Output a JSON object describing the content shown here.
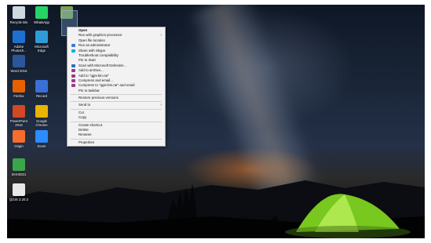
{
  "desktop_icons": [
    {
      "label": "Recycle Bin",
      "icon": "recycle-bin-icon",
      "color": "#cfd8e0"
    },
    {
      "label": "WhatsApp",
      "icon": "whatsapp-icon",
      "color": "#25d366"
    },
    {
      "label": "",
      "icon": "app-icon",
      "color": "#7ea04a"
    },
    {
      "label": "Adobe\nPhotosh...",
      "icon": "photoshop-icon",
      "color": "#1f6fd0"
    },
    {
      "label": "Microsoft\nEdge",
      "icon": "edge-icon",
      "color": "#2f9ad8"
    },
    {
      "label": "Word 2016",
      "icon": "word-icon",
      "color": "#2b579a"
    },
    {
      "label": "Firefox",
      "icon": "firefox-icon",
      "color": "#e66000"
    },
    {
      "label": "Record",
      "icon": "record-icon",
      "color": "#3a6fd8"
    },
    {
      "label": "PowerPoint\n2016",
      "icon": "powerpoint-icon",
      "color": "#d24726"
    },
    {
      "label": "Google\nChrome",
      "icon": "chrome-icon",
      "color": "#e8b400"
    },
    {
      "label": "Origin",
      "icon": "origin-icon",
      "color": "#f56c2d"
    },
    {
      "label": "Zoom",
      "icon": "zoom-icon",
      "color": "#2d8cff"
    },
    {
      "label": "SHH2021",
      "icon": "shh-icon",
      "color": "#3aa54a"
    },
    {
      "label": "QGIS 3.20.3",
      "icon": "qgis-icon",
      "color": "#e8e8e8"
    }
  ],
  "context_menu": [
    {
      "label": "Open",
      "bold": true
    },
    {
      "label": "Run with graphics processor",
      "submenu": true
    },
    {
      "label": "Open file location"
    },
    {
      "label": "Run as administrator",
      "icon": "shield-icon",
      "color": "#3a7bd5"
    },
    {
      "label": "Share with Skype",
      "icon": "skype-icon",
      "color": "#00aff0"
    },
    {
      "label": "Troubleshoot compatibility"
    },
    {
      "label": "Pin to Start"
    },
    {
      "label": "Scan with Microsoft Defender...",
      "icon": "defender-icon",
      "color": "#2f6fbf"
    },
    {
      "label": "Add to archive...",
      "icon": "archive-icon",
      "color": "#9b3a8c"
    },
    {
      "label": "Add to \"qgis-bin.rar\"",
      "icon": "archive-icon",
      "color": "#9b3a8c"
    },
    {
      "label": "Compress and email...",
      "icon": "archive-icon",
      "color": "#9b3a8c"
    },
    {
      "label": "Compress to \"qgis-bin.rar\" and email",
      "icon": "archive-icon",
      "color": "#9b3a8c"
    },
    {
      "label": "Pin to taskbar"
    },
    {
      "sep": true
    },
    {
      "label": "Restore previous versions"
    },
    {
      "sep": true
    },
    {
      "label": "Send to",
      "submenu": true
    },
    {
      "sep": true
    },
    {
      "label": "Cut"
    },
    {
      "label": "Copy"
    },
    {
      "sep": true
    },
    {
      "label": "Create shortcut"
    },
    {
      "label": "Delete"
    },
    {
      "label": "Rename"
    },
    {
      "sep": true
    },
    {
      "label": "Properties"
    }
  ]
}
